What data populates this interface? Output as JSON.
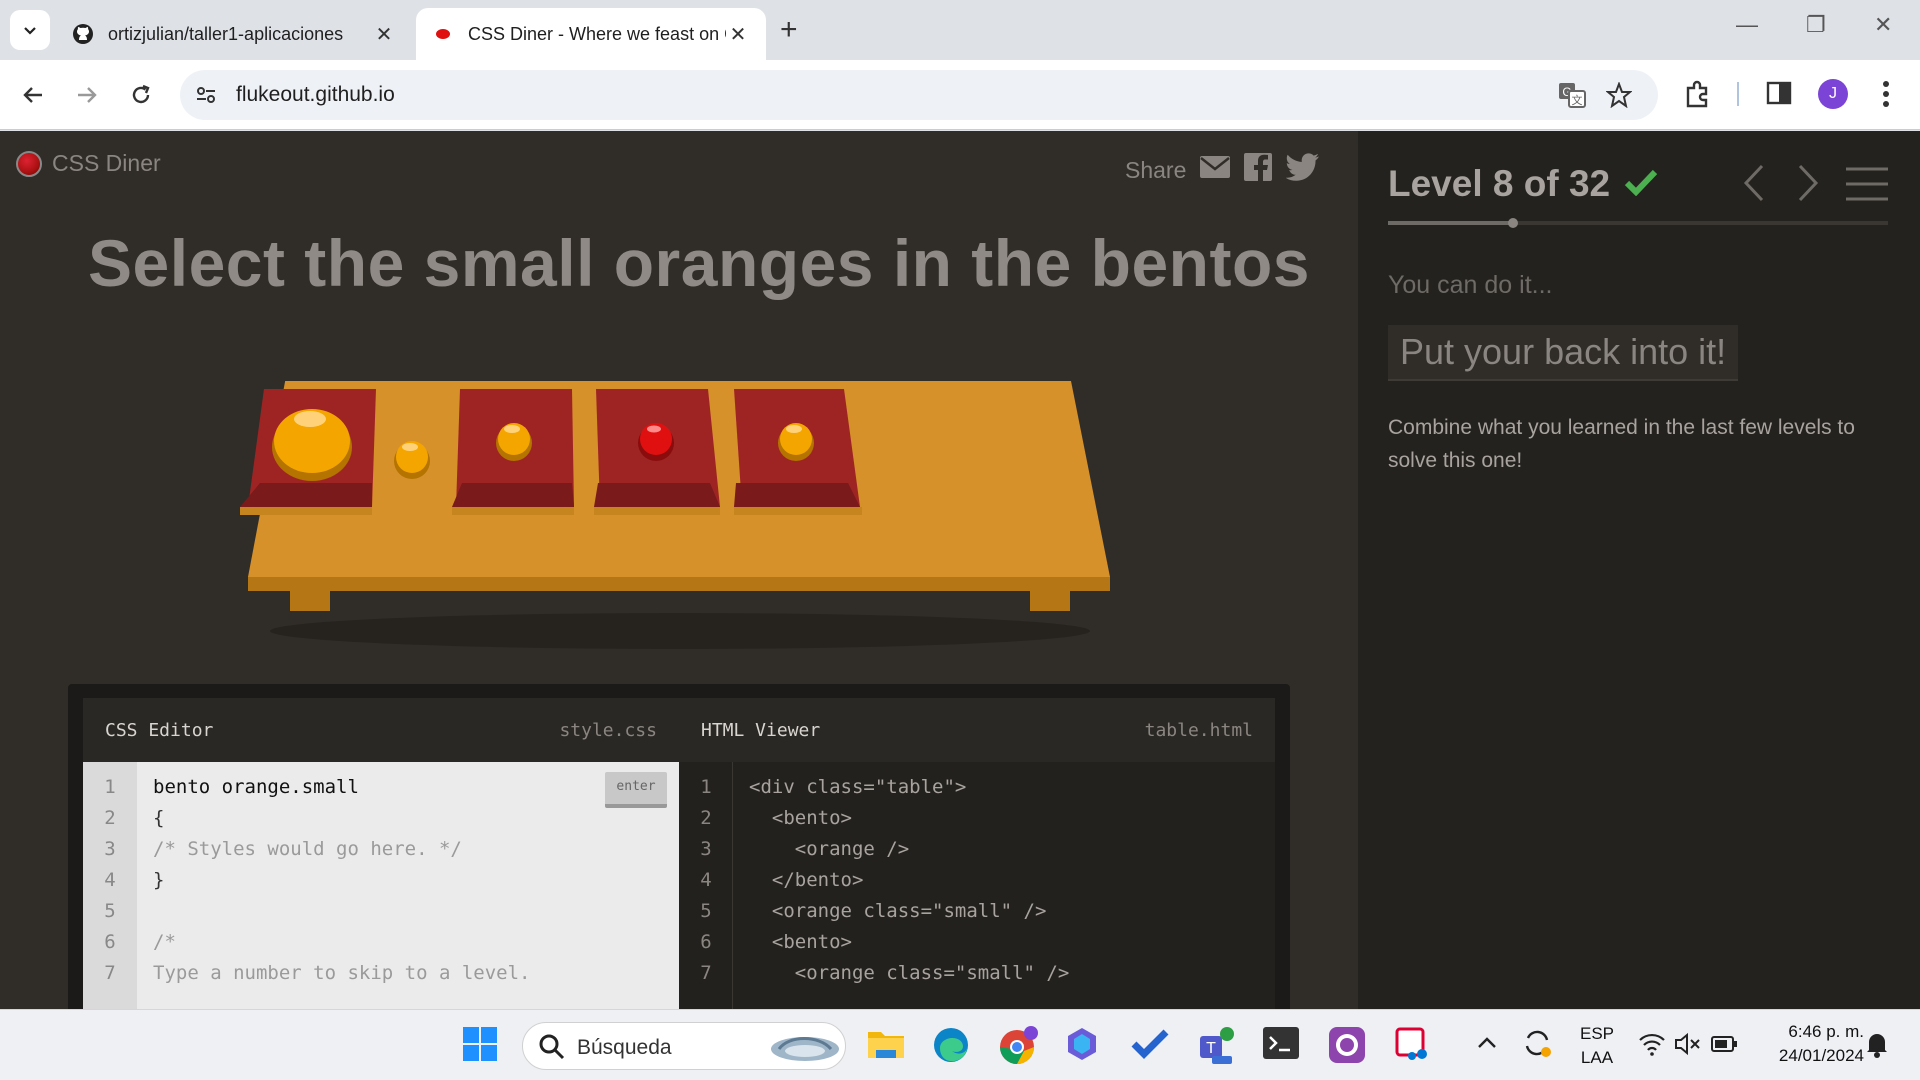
{
  "browser": {
    "tabs": [
      {
        "title": "ortizjulian/taller1-aplicaciones",
        "active": false
      },
      {
        "title": "CSS Diner - Where we feast on CSS",
        "active": true
      }
    ],
    "url": "flukeout.github.io",
    "profile_initial": "J"
  },
  "header": {
    "logo_text": "CSS Diner",
    "share_label": "Share"
  },
  "instruction": "Select the small oranges in the bentos",
  "editor": {
    "css_title": "CSS Editor",
    "css_file": "style.css",
    "html_title": "HTML Viewer",
    "html_file": "table.html",
    "enter_label": "enter",
    "css_lines": [
      {
        "n": "1",
        "text": "bento orange.small"
      },
      {
        "n": "2",
        "text": "{"
      },
      {
        "n": "3",
        "text": "/* Styles would go here. */"
      },
      {
        "n": "4",
        "text": "}"
      },
      {
        "n": "5",
        "text": ""
      },
      {
        "n": "6",
        "text": "/*"
      },
      {
        "n": "7",
        "text": "Type a number to skip to a level."
      }
    ],
    "html_lines": [
      {
        "n": "1",
        "text": "<div class=\"table\">"
      },
      {
        "n": "2",
        "text": "  <bento>"
      },
      {
        "n": "3",
        "text": "    <orange />"
      },
      {
        "n": "4",
        "text": "  </bento>"
      },
      {
        "n": "5",
        "text": "  <orange class=\"small\" />"
      },
      {
        "n": "6",
        "text": "  <bento>"
      },
      {
        "n": "7",
        "text": "    <orange class=\"small\" />"
      }
    ]
  },
  "sidebar": {
    "level_label": "Level 8 of 32",
    "level_progress": 0.25,
    "subtitle": "You can do it...",
    "hint": "Put your back into it!",
    "description": "Combine what you learned in the last few levels to solve this one!"
  },
  "taskbar": {
    "search_label": "Búsqueda",
    "lang_top": "ESP",
    "lang_bottom": "LAA",
    "time": "6:46 p. m.",
    "date": "24/01/2024"
  },
  "colors": {
    "page_bg": "#302d29",
    "sidebar_bg": "#24221f",
    "check": "#4caf50",
    "orange": "#f5a500",
    "apple": "#e01010",
    "bento": "#9e2424",
    "table": "#d6912a"
  }
}
